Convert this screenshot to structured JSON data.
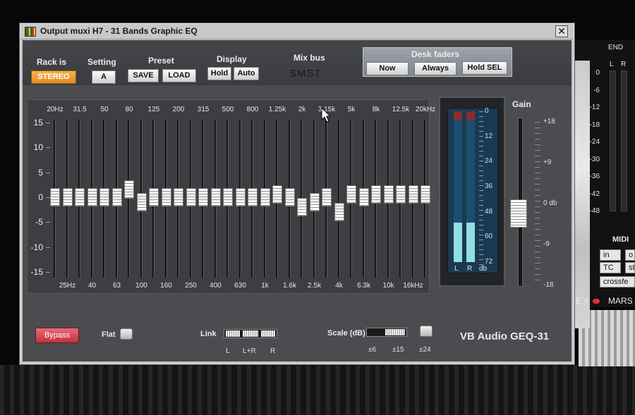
{
  "window": {
    "title": "Output muxi H7 - 31 Bands Graphic EQ",
    "close_glyph": "✕",
    "icon": "eq-app-icon"
  },
  "toolbar": {
    "rack_label": "Rack is",
    "rack_value": "STEREO",
    "setting_label": "Setting",
    "setting_value": "A",
    "preset_label": "Preset",
    "save_label": "SAVE",
    "load_label": "LOAD",
    "display_label": "Display",
    "hold_label": "Hold",
    "auto_label": "Auto",
    "mixbus_label": "Mix bus",
    "mixbus_value": "SMST",
    "desk_label": "Desk faders",
    "now_label": "Now",
    "always_label": "Always",
    "holdsel_label": "Hold SEL"
  },
  "eq": {
    "freq_top": [
      "20Hz",
      "31.5",
      "50",
      "80",
      "125",
      "200",
      "315",
      "500",
      "800",
      "1.25k",
      "2k",
      "3.15k",
      "5k",
      "8k",
      "12.5k",
      "20kHz"
    ],
    "freq_bottom": [
      "25Hz",
      "40",
      "63",
      "100",
      "160",
      "250",
      "400",
      "630",
      "1k",
      "1.6k",
      "2.5k",
      "4k",
      "6.3k",
      "10k",
      "16kHz"
    ],
    "db_labels": [
      "15",
      "10",
      "5",
      "0",
      "-5",
      "-10",
      "-15"
    ],
    "gains_db": [
      0,
      0,
      0,
      0,
      0,
      0,
      1.5,
      -1,
      0,
      0,
      0,
      0,
      0,
      0,
      0,
      0,
      0,
      0,
      0.5,
      0,
      -2,
      -1,
      0,
      -3,
      0.5,
      0,
      0.5,
      0.5,
      0.5,
      0.5,
      0.5
    ]
  },
  "meter": {
    "scale": [
      "0",
      "12",
      "24",
      "36",
      "48",
      "60",
      "72"
    ],
    "left_label": "L",
    "right_label": "R",
    "db_label": "db",
    "left_level": 0.26,
    "right_level": 0.26
  },
  "gain": {
    "label": "Gain",
    "scale": [
      "+18",
      "+9",
      "0 db",
      "-9",
      "-18"
    ],
    "value_db": 0
  },
  "bottom": {
    "bypass_label": "Bypass",
    "flat_label": "Flat",
    "link_label": "Link",
    "link_options": [
      "L",
      "L+R",
      "R"
    ],
    "scale_label": "Scale (dB)",
    "scale_options": [
      "±6",
      "±15",
      "±24"
    ],
    "brand": "VB Audio  GEQ-31"
  },
  "second_window": {
    "end_label": "END",
    "lr_l": "L",
    "lr_r": "R",
    "red_mark": "e",
    "scale": [
      "0",
      "-6",
      "-12",
      "-18",
      "-24",
      "-30",
      "-36",
      "-42",
      "-48"
    ],
    "midi_label": "MIDI",
    "btn_in": "in",
    "btn_o": "o",
    "btn_tc": "TC",
    "btn_st": "st",
    "btn_crossfe": "crossfe",
    "strip_text": "E 4",
    "strip_text2": "MARS"
  },
  "colors": {
    "accent_orange": "#e58b1d",
    "bypass_red": "#c2323f",
    "meter_cyan": "#8fe0e2"
  }
}
